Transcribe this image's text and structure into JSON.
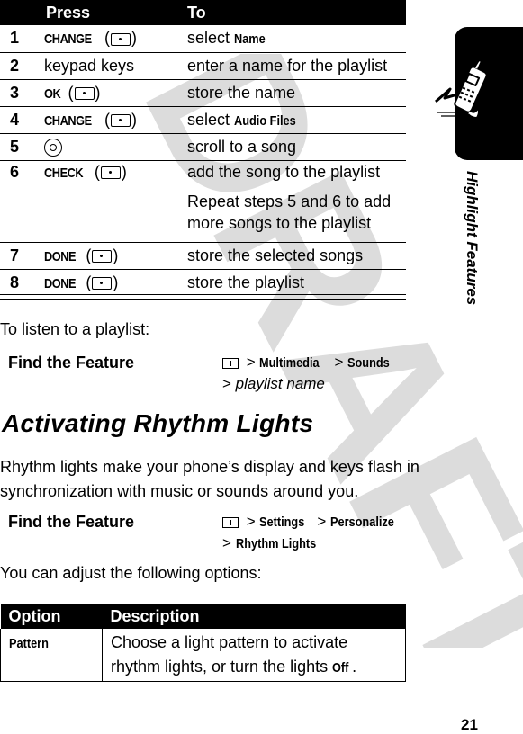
{
  "steps_table": {
    "headers": {
      "num": "",
      "press": "Press",
      "to": "To"
    },
    "rows": [
      {
        "num": "1",
        "press_key": "CHANGE",
        "press_icon": "softkey-right-icon",
        "to_text": "select ",
        "to_bold": "Name"
      },
      {
        "num": "2",
        "press_text": "keypad keys",
        "to_text": "enter a name for the playlist"
      },
      {
        "num": "3",
        "press_key": "OK",
        "press_icon": "softkey-right-icon",
        "to_text": "store the name"
      },
      {
        "num": "4",
        "press_key": "CHANGE",
        "press_icon": "softkey-right-icon",
        "to_text": "select ",
        "to_bold": "Audio Files"
      },
      {
        "num": "5",
        "press_icon": "nav-key-icon",
        "to_text": "scroll to a song"
      },
      {
        "num": "6",
        "press_key": "CHECK",
        "press_icon": "softkey-right-icon",
        "to_text": "add the song to the playlist",
        "note": "Repeat steps 5 and 6 to add more songs to the playlist"
      },
      {
        "num": "7",
        "press_key": "DONE",
        "press_icon": "softkey-left-icon",
        "to_text": "store the selected songs"
      },
      {
        "num": "8",
        "press_key": "DONE",
        "press_icon": "softkey-left-icon",
        "to_text": "store the playlist"
      }
    ]
  },
  "listen_intro": "To listen to a playlist:",
  "find_feature_1": {
    "label": "Find the Feature",
    "icon": "menu-key-icon",
    "path": [
      "Multimedia",
      "Sounds"
    ],
    "path_italic": "playlist name"
  },
  "section_heading": "Activating Rhythm Lights",
  "section_body": "Rhythm lights make your phone’s display and keys flash in synchronization with music or sounds around you.",
  "find_feature_2": {
    "label": "Find the Feature",
    "icon": "menu-key-icon",
    "path": [
      "Settings",
      "Personalize",
      "Rhythm Lights"
    ]
  },
  "options_intro": "You can adjust the following options:",
  "options_table": {
    "headers": [
      "Option",
      "Description"
    ],
    "rows": [
      {
        "option": "Pattern",
        "desc": "Choose a light pattern to activate rhythm lights, or turn the lights ",
        "desc_bold": "Off",
        "desc_end": "."
      }
    ]
  },
  "side_tab": {
    "title": "Highlight Features",
    "icon": "running-phone-icon"
  },
  "watermark": "DRAFT",
  "page_number": "21",
  "separator": ">",
  "colors": {
    "ink": "#000000",
    "watermark": "#dcdcdc",
    "paper": "#ffffff"
  }
}
